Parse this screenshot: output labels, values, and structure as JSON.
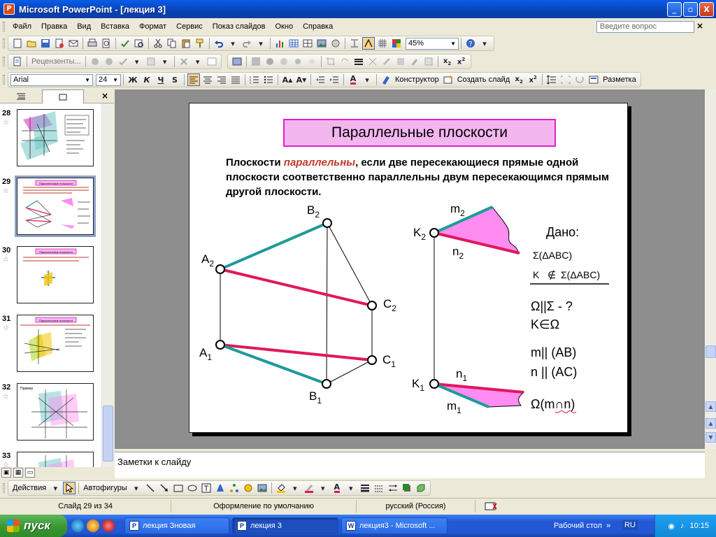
{
  "window": {
    "title": "Microsoft PowerPoint - [лекция 3]",
    "controls": [
      "_",
      "▫",
      "X"
    ]
  },
  "menubar": {
    "items": [
      "Файл",
      "Правка",
      "Вид",
      "Вставка",
      "Формат",
      "Сервис",
      "Показ слайдов",
      "Окно",
      "Справка"
    ],
    "ask_placeholder": "Введите вопрос",
    "close": "×"
  },
  "toolbar_standard": {
    "zoom": "45%"
  },
  "toolbar_review": {
    "reviewers_label": "Рецензенты..."
  },
  "toolbar_format": {
    "font": "Arial",
    "size": "24",
    "bold": "Ж",
    "italic": "К",
    "underline": "Ч",
    "shadow": "S",
    "designer": "Конструктор",
    "new_slide": "Создать слайд",
    "layout": "Разметка"
  },
  "sidepanel": {
    "close": "×",
    "slides": [
      {
        "num": "28",
        "selected": false
      },
      {
        "num": "29",
        "selected": true
      },
      {
        "num": "30",
        "selected": false
      },
      {
        "num": "31",
        "selected": false
      },
      {
        "num": "32",
        "selected": false
      },
      {
        "num": "33",
        "selected": false
      }
    ],
    "thumb_titles": {
      "s29": "Параллельные плоскости",
      "s30": "Параллельные плоскости",
      "s31": "Параллельные плоскости",
      "s32": "Пример"
    }
  },
  "slide": {
    "title": "Параллельные плоскости",
    "text_before": "Плоскости ",
    "text_highlight": "параллельны",
    "text_after": ", если две пересекающиеся прямые одной плоскости соответственно параллельны двум пересекающимся прямым другой плоскости.",
    "labels": {
      "A2": "A",
      "B2": "B",
      "C2": "C",
      "A1": "A",
      "B1": "B",
      "C1": "C",
      "K2": "K",
      "K1": "K",
      "m2": "m",
      "n2": "n",
      "m1": "m",
      "n1": "n",
      "sub1": "1",
      "sub2": "2"
    },
    "given": {
      "heading": "Дано:",
      "line1": "Σ(ΔABC)",
      "line2_k": "K",
      "line2_rel": "∉",
      "line2_set": "Σ(ΔABC)",
      "line3": "Ω||Σ - ?",
      "line4": "K∈Ω",
      "line5": "m|| (AB)",
      "line6": "n || (AC)",
      "line7": "Ω(m∩n)"
    },
    "colors": {
      "teal": "#1f9a9a",
      "crimson": "#e0185c",
      "fill": "#ff8cf0",
      "title_border": "#e21fc9",
      "title_bg": "#f3b6ee"
    }
  },
  "notes": {
    "placeholder": "Заметки к слайду"
  },
  "drawbar": {
    "actions": "Действия",
    "autoshapes": "Автофигуры"
  },
  "status": {
    "slide": "Слайд 29 из 34",
    "design": "Оформление по умолчанию",
    "language": "русский (Россия)"
  },
  "taskbar": {
    "start": "пуск",
    "tasks": [
      "лекция Зновая",
      "лекция 3",
      "лекция3 - Microsoft ..."
    ],
    "desktop": "Рабочий стол",
    "lang": "RU",
    "time": "10:15"
  }
}
